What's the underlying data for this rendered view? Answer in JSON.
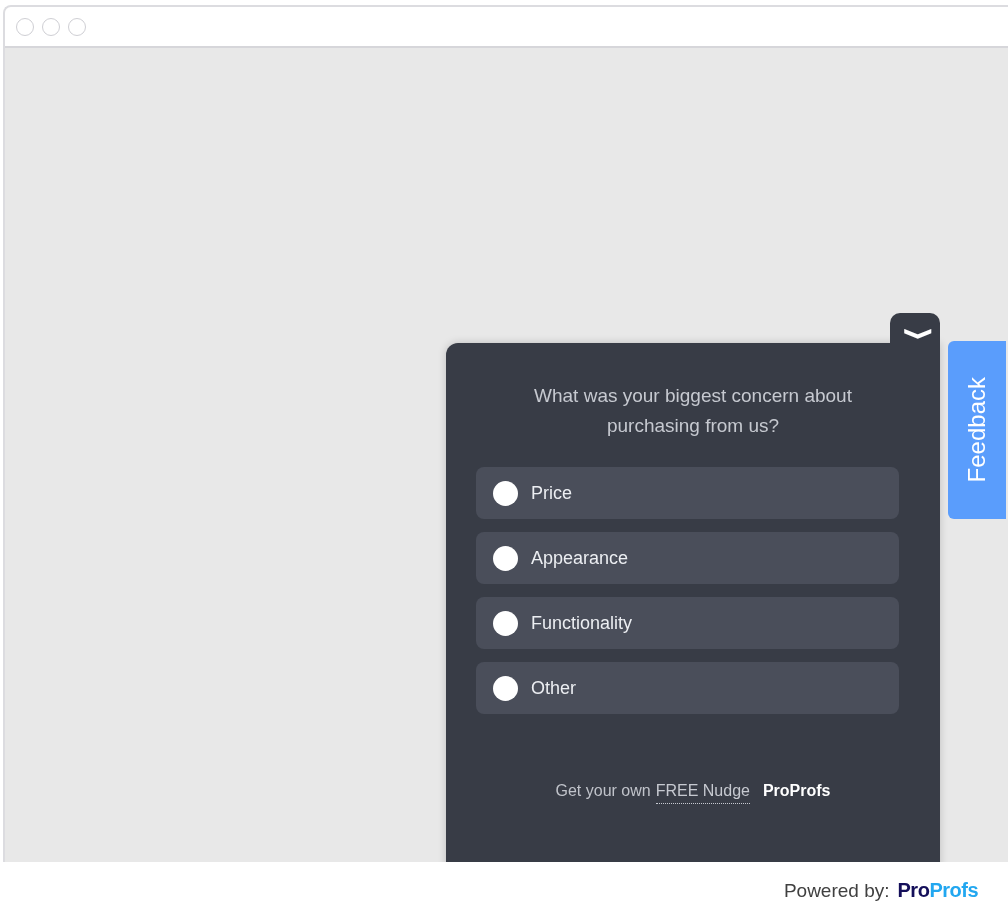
{
  "widget": {
    "question": "What was your biggest concern about purchasing from us?",
    "options": [
      {
        "label": "Price",
        "selected": false
      },
      {
        "label": "Appearance",
        "selected": false
      },
      {
        "label": "Functionality",
        "selected": false
      },
      {
        "label": "Other",
        "selected": false
      }
    ],
    "footer": {
      "text": "Get your own",
      "link": "FREE Nudge",
      "brand": "ProProfs"
    },
    "collapse_button": "❯"
  },
  "feedback_tab": "Feedback",
  "powered_by": {
    "text": "Powered by:",
    "logo_parts": [
      "Pro",
      "Profs"
    ]
  }
}
